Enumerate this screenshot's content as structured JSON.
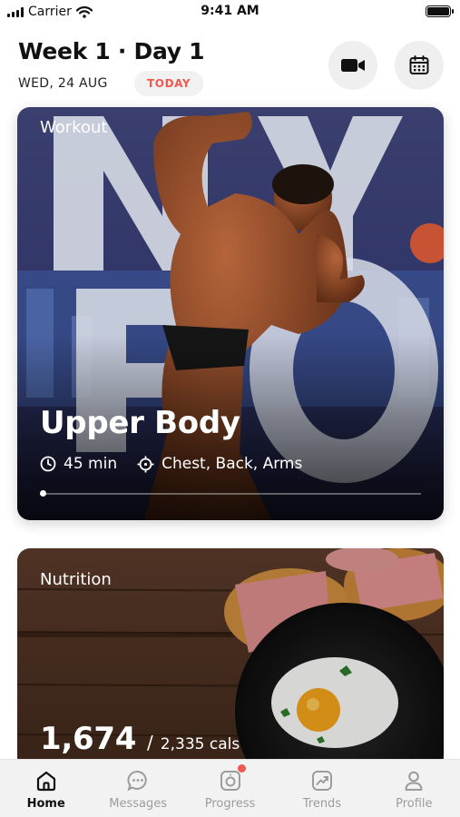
{
  "status_bar": {
    "carrier": "Carrier",
    "time": "9:41 AM"
  },
  "header": {
    "title": "Week 1 · Day 1",
    "date": "WED, 24 AUG",
    "today_badge": "TODAY",
    "video_icon": "video-camera-icon",
    "calendar_icon": "calendar-icon"
  },
  "workout_card": {
    "tag": "Workout",
    "title": "Upper Body",
    "duration": "45 min",
    "muscles": "Chest, Back, Arms",
    "progress": 0
  },
  "nutrition_card": {
    "tag": "Nutrition",
    "calories_eaten": "1,674",
    "calories_goal": "2,335 cals"
  },
  "tabbar": {
    "tabs": [
      {
        "label": "Home",
        "icon": "home-icon",
        "active": true
      },
      {
        "label": "Messages",
        "icon": "chat-icon",
        "active": false
      },
      {
        "label": "Progress",
        "icon": "camera-icon",
        "active": false,
        "badge": true
      },
      {
        "label": "Trends",
        "icon": "trend-icon",
        "active": false
      },
      {
        "label": "Profile",
        "icon": "user-icon",
        "active": false
      }
    ]
  },
  "colors": {
    "accent": "#ee5a4f",
    "active_tab": "#111111",
    "inactive_tab": "#9c9c9c"
  }
}
